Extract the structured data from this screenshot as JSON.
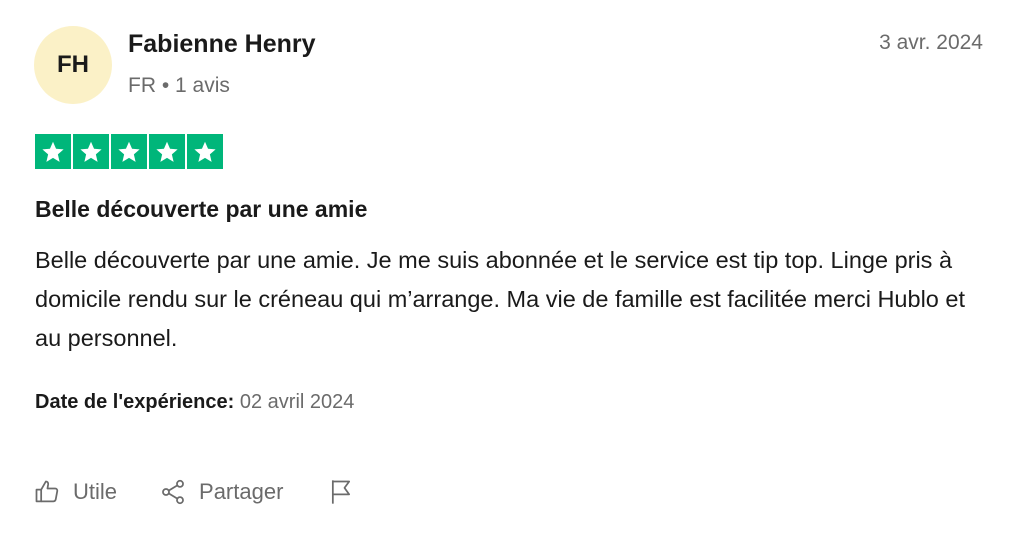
{
  "reviewer": {
    "initials": "FH",
    "name": "Fabienne Henry",
    "country": "FR",
    "separator": "•",
    "review_count": "1 avis"
  },
  "review": {
    "date": "3 avr. 2024",
    "rating": 5,
    "title": "Belle découverte par une amie",
    "body": "Belle découverte par une amie. Je me suis abonnée et le service est tip top. Linge pris à domicile rendu sur le créneau qui m’arrange. Ma vie de famille est facilitée merci Hublo et au personnel.",
    "experience_label": "Date de l'expérience:",
    "experience_date": "02 avril 2024"
  },
  "actions": {
    "useful_label": "Utile",
    "share_label": "Partager",
    "report_icon": "flag-icon"
  },
  "colors": {
    "star_bg": "#00b67a",
    "avatar_bg": "#fbf1c7",
    "muted_text": "#6b6b6b"
  }
}
